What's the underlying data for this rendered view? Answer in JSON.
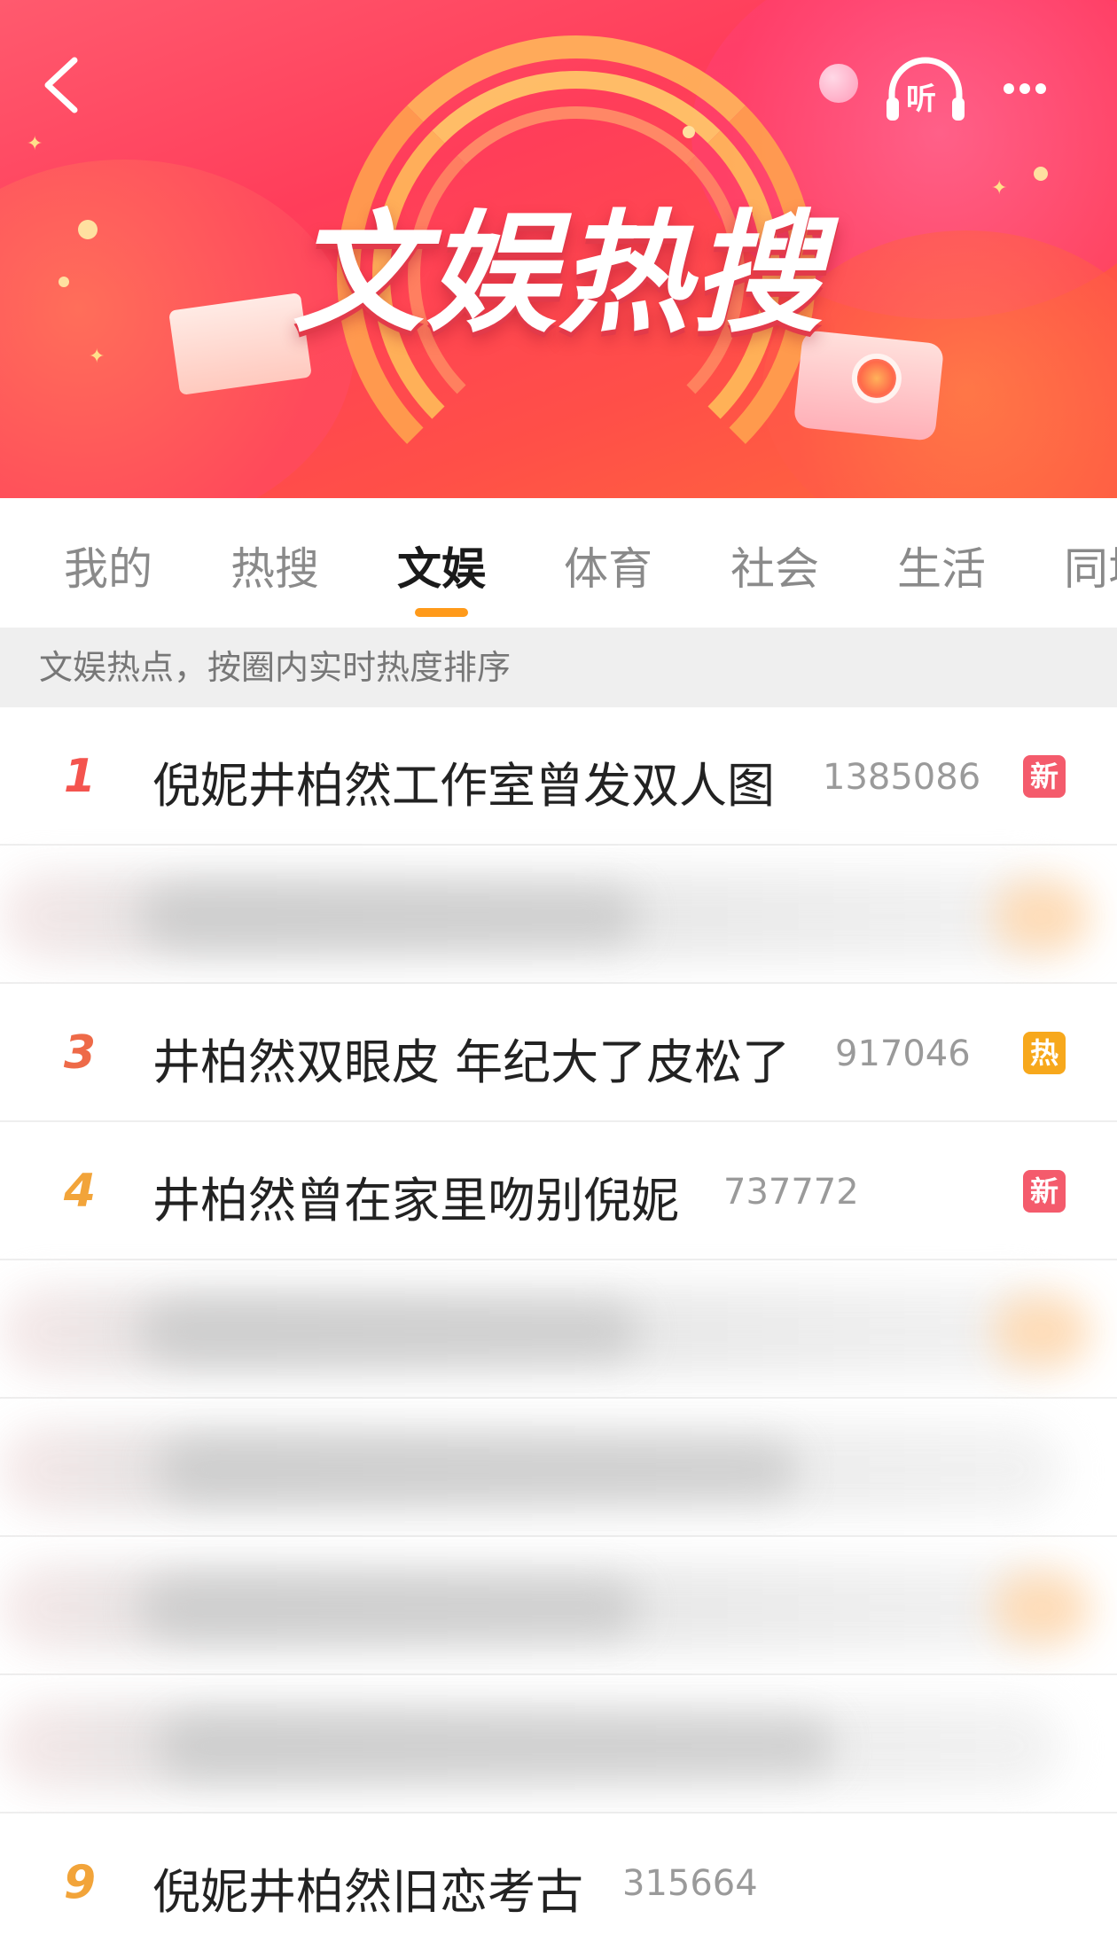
{
  "header": {
    "banner_title": "文娱热搜",
    "listen_label": "听",
    "back_icon": "chevron-left-icon",
    "more_icon": "more-horizontal-icon",
    "listen_icon": "headphones-icon"
  },
  "tabs": [
    {
      "label": "我的",
      "active": false
    },
    {
      "label": "热搜",
      "active": false
    },
    {
      "label": "文娱",
      "active": true
    },
    {
      "label": "体育",
      "active": false
    },
    {
      "label": "社会",
      "active": false
    },
    {
      "label": "生活",
      "active": false
    },
    {
      "label": "同城",
      "active": false
    }
  ],
  "subtitle": "文娱热点，按圈内实时热度排序",
  "list": [
    {
      "rank": "1",
      "title": "倪妮井柏然工作室曾发双人图",
      "count": "1385086",
      "badge": "新",
      "badge_type": "new",
      "blurred": false
    },
    {
      "rank": "",
      "title": "",
      "count": "",
      "badge": "",
      "badge_type": "",
      "blurred": true
    },
    {
      "rank": "3",
      "title": "井柏然双眼皮 年纪大了皮松了",
      "count": "917046",
      "badge": "热",
      "badge_type": "hot",
      "blurred": false
    },
    {
      "rank": "4",
      "title": "井柏然曾在家里吻别倪妮",
      "count": "737772",
      "badge": "新",
      "badge_type": "new",
      "blurred": false
    },
    {
      "rank": "",
      "title": "",
      "count": "",
      "badge": "",
      "badge_type": "",
      "blurred": true
    },
    {
      "rank": "",
      "title": "",
      "count": "",
      "badge": "",
      "badge_type": "",
      "blurred": true
    },
    {
      "rank": "",
      "title": "",
      "count": "",
      "badge": "",
      "badge_type": "",
      "blurred": true
    },
    {
      "rank": "",
      "title": "",
      "count": "",
      "badge": "",
      "badge_type": "",
      "blurred": true
    },
    {
      "rank": "9",
      "title": "倪妮井柏然旧恋考古",
      "count": "315664",
      "badge": "",
      "badge_type": "",
      "blurred": false
    }
  ],
  "colors": {
    "accent_orange": "#ff9a1a",
    "badge_new": "#f45b6c",
    "badge_hot": "#f7a81c",
    "rank_top": "#f4544e"
  }
}
